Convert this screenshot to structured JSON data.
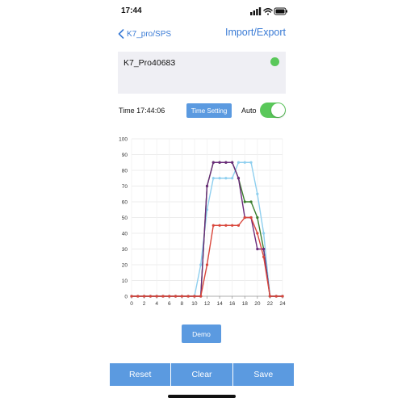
{
  "status_bar": {
    "time": "17:44"
  },
  "nav": {
    "back_label": "K7_pro/SPS",
    "title": "Import/Export"
  },
  "device": {
    "name": "K7_Pro40683",
    "status_color": "#5ac85a"
  },
  "time_row": {
    "time_text": "Time 17:44:06",
    "time_setting_label": "Time Setting",
    "auto_label": "Auto",
    "auto_enabled": true
  },
  "chart_data": {
    "type": "line",
    "x": [
      0,
      1,
      2,
      3,
      4,
      5,
      6,
      7,
      8,
      9,
      10,
      11,
      12,
      13,
      14,
      15,
      16,
      17,
      18,
      19,
      20,
      21,
      22,
      23,
      24
    ],
    "xticks": [
      0,
      2,
      4,
      6,
      8,
      10,
      12,
      14,
      16,
      18,
      20,
      22,
      24
    ],
    "yticks": [
      0,
      10,
      20,
      30,
      40,
      50,
      60,
      70,
      80,
      90,
      100
    ],
    "xlim": [
      0,
      24
    ],
    "ylim": [
      0,
      100
    ],
    "grid": true,
    "series": [
      {
        "color": "#8ecfef",
        "values": [
          0,
          0,
          0,
          0,
          0,
          0,
          0,
          0,
          0,
          0,
          0,
          20,
          55,
          75,
          75,
          75,
          75,
          85,
          85,
          85,
          65,
          40,
          0,
          0,
          0
        ]
      },
      {
        "color": "#3a7d2c",
        "values": [
          0,
          0,
          0,
          0,
          0,
          0,
          0,
          0,
          0,
          0,
          0,
          0,
          70,
          85,
          85,
          85,
          85,
          75,
          60,
          60,
          50,
          30,
          0,
          0,
          0
        ]
      },
      {
        "color": "#6a2a7a",
        "values": [
          0,
          0,
          0,
          0,
          0,
          0,
          0,
          0,
          0,
          0,
          0,
          0,
          70,
          85,
          85,
          85,
          85,
          75,
          50,
          50,
          30,
          30,
          0,
          0,
          0
        ]
      },
      {
        "color": "#d9463b",
        "values": [
          0,
          0,
          0,
          0,
          0,
          0,
          0,
          0,
          0,
          0,
          0,
          0,
          20,
          45,
          45,
          45,
          45,
          45,
          50,
          50,
          40,
          25,
          0,
          0,
          0
        ]
      }
    ]
  },
  "demo_label": "Demo",
  "bottom": {
    "reset": "Reset",
    "clear": "Clear",
    "save": "Save"
  },
  "colors": {
    "accent": "#5b9ae0",
    "link": "#3a7bd5",
    "toggle_on": "#5ac85a"
  }
}
